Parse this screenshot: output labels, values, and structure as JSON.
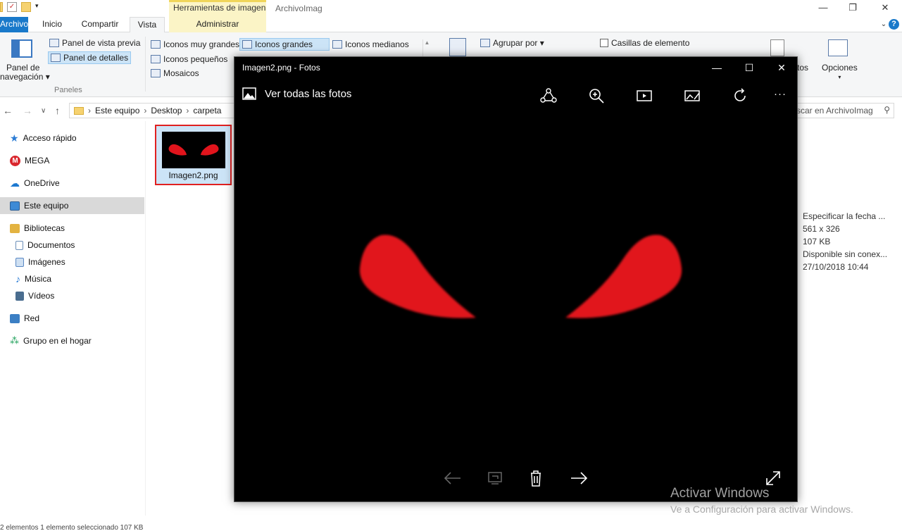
{
  "explorer": {
    "title": "ArchivoImag",
    "context_tab": "Herramientas de imagen",
    "tabs": [
      "Archivo",
      "Inicio",
      "Compartir",
      "Vista",
      "Administrar"
    ],
    "ribbon": {
      "nav_pane": "Panel de navegación",
      "nav_pane_line1": "Panel de",
      "nav_pane_line2": "navegación",
      "preview_pane": "Panel de vista previa",
      "details_pane": "Panel de detalles",
      "group_panels": "Paneles",
      "layout": [
        "Iconos muy grandes",
        "Iconos grandes",
        "Iconos medianos",
        "Iconos pequeños",
        "Mosaicos"
      ],
      "group_by": "Agrupar por",
      "item_checkboxes": "Casillas de elemento",
      "options": "Opciones",
      "partial_right": "tos"
    },
    "address": [
      "Este equipo",
      "Desktop",
      "carpeta"
    ],
    "search_placeholder": "scar en ArchivoImag",
    "sidebar": [
      {
        "label": "Acceso rápido",
        "icon": "star-icon",
        "color": "#2a7bd4"
      },
      {
        "label": "MEGA",
        "icon": "mega-icon",
        "color": "#d9272e"
      },
      {
        "label": "OneDrive",
        "icon": "cloud-icon",
        "color": "#1b78d0"
      },
      {
        "label": "Este equipo",
        "icon": "computer-icon",
        "color": "#3d8ad6"
      },
      {
        "label": "Bibliotecas",
        "icon": "library-icon",
        "color": "#e3b341"
      },
      {
        "label": "Documentos",
        "icon": "document-icon",
        "color": "#6b8fb8"
      },
      {
        "label": "Imágenes",
        "icon": "image-icon",
        "color": "#5a88c4"
      },
      {
        "label": "Música",
        "icon": "music-icon",
        "color": "#2a7bd4"
      },
      {
        "label": "Vídeos",
        "icon": "video-icon",
        "color": "#4a6d8f"
      },
      {
        "label": "Red",
        "icon": "network-icon",
        "color": "#3b7fc4"
      },
      {
        "label": "Grupo en el hogar",
        "icon": "homegroup-icon",
        "color": "#1fa05a"
      }
    ],
    "file": {
      "name": "Imagen2.png"
    },
    "details": [
      "Especificar la fecha ...",
      "561 x 326",
      "107 KB",
      "Disponible sin conex...",
      "27/10/2018 10:44"
    ],
    "status": "2 elementos   1 elemento seleccionado  107 KB"
  },
  "photos": {
    "title": "Imagen2.png - Fotos",
    "see_all": "Ver todas las fotos",
    "more": "···",
    "tools": [
      "share-icon",
      "zoom-icon",
      "slideshow-icon",
      "edit-icon",
      "rotate-icon"
    ],
    "bottom_tools": [
      "previous-icon",
      "compare-icon",
      "delete-icon",
      "next-icon",
      "fullscreen-icon"
    ],
    "eye_color": "#e1141c"
  },
  "watermark": {
    "line1": "Activar Windows",
    "line2": "Ve a Configuración para activar Windows."
  }
}
